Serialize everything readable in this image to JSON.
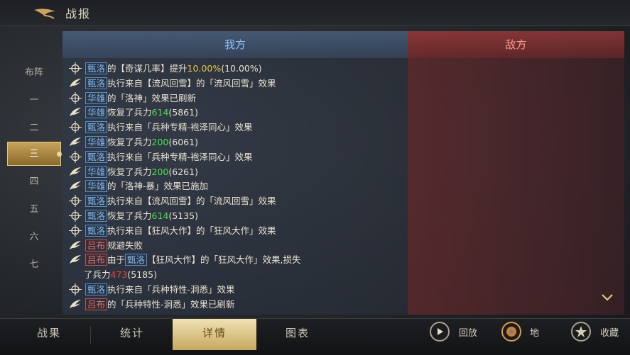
{
  "header": {
    "title": "战报"
  },
  "side_nav": {
    "items": [
      "布阵",
      "一",
      "二",
      "三",
      "四",
      "五",
      "六",
      "七"
    ],
    "active_index": 3
  },
  "panel": {
    "tab_ours": "我方",
    "tab_enemy": "敌方"
  },
  "log": [
    {
      "icon": "strategy-icon",
      "segments": [
        {
          "t": "甄洛",
          "c": "name-blue"
        },
        {
          "t": "的【奇谋几率】提升"
        },
        {
          "t": "10.00%",
          "c": "yellow"
        },
        {
          "t": "(10.00%)"
        }
      ]
    },
    {
      "icon": "wing-icon",
      "segments": [
        {
          "t": "甄洛",
          "c": "name-blue"
        },
        {
          "t": "执行来自【流风回雪】的「流风回雪」效果"
        }
      ]
    },
    {
      "icon": "strategy-icon",
      "segments": [
        {
          "t": "华雄",
          "c": "name-blue"
        },
        {
          "t": "的「洛神」效果已刷新"
        }
      ]
    },
    {
      "icon": "wing-icon",
      "segments": [
        {
          "t": "华雄",
          "c": "name-blue"
        },
        {
          "t": "恢复了兵力"
        },
        {
          "t": "614",
          "c": "green"
        },
        {
          "t": "(5861)"
        }
      ]
    },
    {
      "icon": "strategy-icon",
      "segments": [
        {
          "t": "甄洛",
          "c": "name-blue"
        },
        {
          "t": "执行来自「兵种专精-袍泽同心」效果"
        }
      ]
    },
    {
      "icon": "wing-icon",
      "segments": [
        {
          "t": "华雄",
          "c": "name-blue"
        },
        {
          "t": "恢复了兵力"
        },
        {
          "t": "200",
          "c": "green"
        },
        {
          "t": "(6061)"
        }
      ]
    },
    {
      "icon": "strategy-icon",
      "segments": [
        {
          "t": "甄洛",
          "c": "name-blue"
        },
        {
          "t": "执行来自「兵种专精-袍泽同心」效果"
        }
      ]
    },
    {
      "icon": "wing-icon",
      "segments": [
        {
          "t": "华雄",
          "c": "name-blue"
        },
        {
          "t": "恢复了兵力"
        },
        {
          "t": "200",
          "c": "green"
        },
        {
          "t": "(6261)"
        }
      ]
    },
    {
      "icon": "wing-icon",
      "segments": [
        {
          "t": "华雄",
          "c": "name-blue"
        },
        {
          "t": "的「洛神-暴」效果已施加"
        }
      ]
    },
    {
      "icon": "strategy-icon",
      "segments": [
        {
          "t": "甄洛",
          "c": "name-blue"
        },
        {
          "t": "执行来自【流风回雪】的「流风回雪」效果"
        }
      ]
    },
    {
      "icon": "strategy-icon",
      "segments": [
        {
          "t": "甄洛",
          "c": "name-blue"
        },
        {
          "t": "恢复了兵力"
        },
        {
          "t": "614",
          "c": "green"
        },
        {
          "t": "(5135)"
        }
      ]
    },
    {
      "icon": "strategy-icon",
      "segments": [
        {
          "t": "甄洛",
          "c": "name-blue"
        },
        {
          "t": "执行来自【狂风大作】的「狂风大作」效果"
        }
      ]
    },
    {
      "icon": "wing-icon",
      "segments": [
        {
          "t": "吕布",
          "c": "name-red"
        },
        {
          "t": "规避失败"
        }
      ]
    },
    {
      "icon": "wing-icon",
      "segments": [
        {
          "t": "吕布",
          "c": "name-red"
        },
        {
          "t": "由于"
        },
        {
          "t": "甄洛",
          "c": "name-blue"
        },
        {
          "t": "【狂风大作】的「狂风大作」效果,损失"
        }
      ]
    },
    {
      "icon": "",
      "segments": [
        {
          "t": "了兵力"
        },
        {
          "t": "473",
          "c": "red"
        },
        {
          "t": "(5185)"
        }
      ]
    },
    {
      "icon": "strategy-icon",
      "segments": [
        {
          "t": "甄洛",
          "c": "name-blue"
        },
        {
          "t": "执行来自「兵种特性-洞悉」效果"
        }
      ]
    },
    {
      "icon": "wing-icon",
      "segments": [
        {
          "t": "吕布",
          "c": "name-red"
        },
        {
          "t": "的「兵种特性-洞悉」效果已刷新"
        }
      ]
    }
  ],
  "bottom_tabs": [
    "战果",
    "统计",
    "详情",
    "图表"
  ],
  "bottom_active": 2,
  "actions": {
    "replay": "回放",
    "map": "地",
    "collect": "收藏"
  },
  "colors": {
    "name_blue": "#78b6f2",
    "name_red": "#ef6a5c",
    "value_green": "#47e04b",
    "value_yellow": "#e3c64a",
    "value_red": "#e2483f"
  }
}
